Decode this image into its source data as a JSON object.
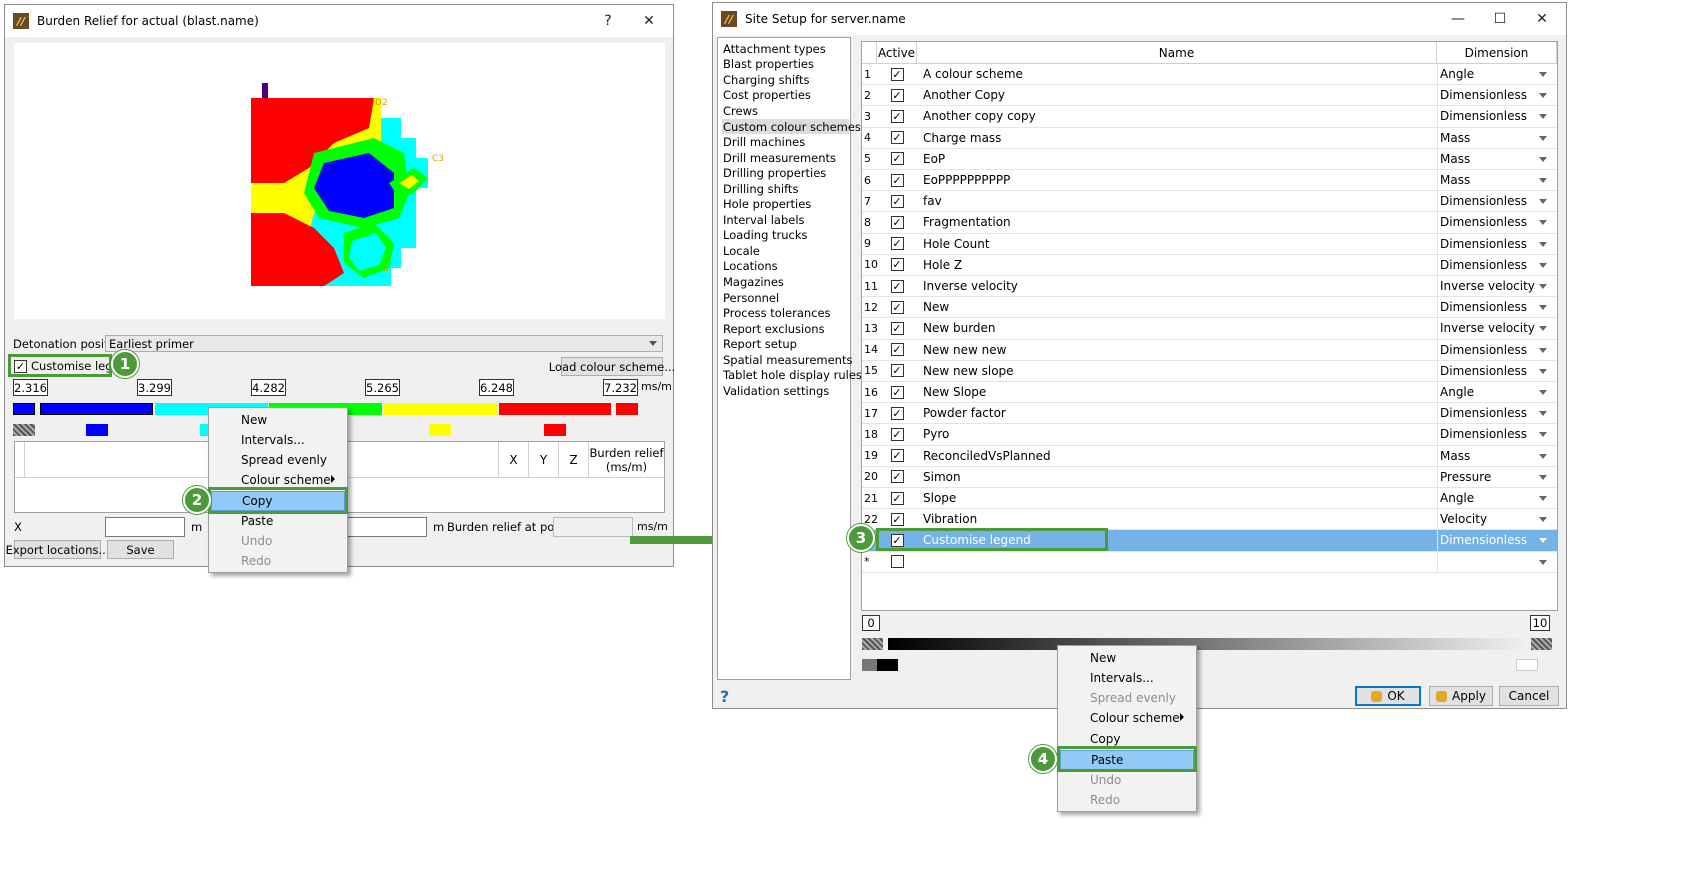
{
  "left_window": {
    "title": "Burden Relief for actual (blast.name)",
    "help_glyph": "?",
    "close_glyph": "✕",
    "plot_labels": [
      "D2",
      "C3",
      "2"
    ],
    "detonation_label": "Detonation position",
    "detonation_value": "Earliest primer",
    "customise_legend_label": "Customise legend",
    "customise_legend_checked": true,
    "load_scheme_button": "Load colour scheme...",
    "ticks": [
      "2.316",
      "3.299",
      "4.282",
      "5.265",
      "6.248",
      "7.232"
    ],
    "unit_label": "ms/m",
    "legend_colors": [
      "#0000ff",
      "#00ffff",
      "#00ff00",
      "#ffff00",
      "#ff0000"
    ],
    "table_headers": [
      "X",
      "Y",
      "Z",
      "Burden relief (ms/m)"
    ],
    "x_label": "X",
    "m_label": "m",
    "burden_relief_at_point_label": "Burden relief at point",
    "export_button": "Export locations...",
    "save_button": "Save"
  },
  "left_menu": {
    "items": [
      {
        "label": "New",
        "disabled": false
      },
      {
        "label": "Intervals...",
        "disabled": false
      },
      {
        "label": "Spread evenly",
        "disabled": false
      },
      {
        "label": "Colour scheme",
        "disabled": false,
        "submenu": true
      },
      {
        "label": "Copy",
        "disabled": false,
        "selected": true
      },
      {
        "label": "Paste",
        "disabled": false
      },
      {
        "label": "Undo",
        "disabled": true
      },
      {
        "label": "Redo",
        "disabled": true
      }
    ]
  },
  "right_window": {
    "title": "Site Setup for server.name",
    "min_glyph": "—",
    "max_glyph": "☐",
    "close_glyph": "✕",
    "sidebar_items": [
      "Attachment types",
      "Blast properties",
      "Charging shifts",
      "Cost properties",
      "Crews",
      "Custom colour schemes",
      "Drill machines",
      "Drill measurements",
      "Drilling properties",
      "Drilling shifts",
      "Hole properties",
      "Interval labels",
      "Loading trucks",
      "Locale",
      "Locations",
      "Magazines",
      "Personnel",
      "Process tolerances",
      "Report exclusions",
      "Report setup",
      "Spatial measurements",
      "Tablet hole display rules",
      "Validation settings"
    ],
    "sidebar_selected_index": 5,
    "table_headers": {
      "active": "Active",
      "name": "Name",
      "dimension": "Dimension"
    },
    "rows": [
      {
        "num": "1",
        "name": "A colour scheme",
        "dimension": "Angle"
      },
      {
        "num": "2",
        "name": "Another Copy",
        "dimension": "Dimensionless"
      },
      {
        "num": "3",
        "name": "Another copy copy",
        "dimension": "Dimensionless"
      },
      {
        "num": "4",
        "name": "Charge mass",
        "dimension": "Mass"
      },
      {
        "num": "5",
        "name": "EoP",
        "dimension": "Mass"
      },
      {
        "num": "6",
        "name": "EoPPPPPPPPPP",
        "dimension": "Mass"
      },
      {
        "num": "7",
        "name": "fav",
        "dimension": "Dimensionless"
      },
      {
        "num": "8",
        "name": "Fragmentation",
        "dimension": "Dimensionless"
      },
      {
        "num": "9",
        "name": "Hole Count",
        "dimension": "Dimensionless"
      },
      {
        "num": "10",
        "name": "Hole Z",
        "dimension": "Dimensionless"
      },
      {
        "num": "11",
        "name": "Inverse velocity",
        "dimension": "Inverse velocity"
      },
      {
        "num": "12",
        "name": "New",
        "dimension": "Dimensionless"
      },
      {
        "num": "13",
        "name": "New burden",
        "dimension": "Inverse velocity"
      },
      {
        "num": "14",
        "name": "New new new",
        "dimension": "Dimensionless"
      },
      {
        "num": "15",
        "name": "New new slope",
        "dimension": "Dimensionless"
      },
      {
        "num": "16",
        "name": "New Slope",
        "dimension": "Angle"
      },
      {
        "num": "17",
        "name": "Powder factor",
        "dimension": "Dimensionless"
      },
      {
        "num": "18",
        "name": "Pyro",
        "dimension": "Dimensionless"
      },
      {
        "num": "19",
        "name": "ReconciledVsPlanned",
        "dimension": "Mass"
      },
      {
        "num": "20",
        "name": "Simon",
        "dimension": "Pressure"
      },
      {
        "num": "21",
        "name": "Slope",
        "dimension": "Angle"
      },
      {
        "num": "22",
        "name": "Vibration",
        "dimension": "Velocity"
      },
      {
        "num": "",
        "name": "Customise legend",
        "dimension": "Dimensionless",
        "selected": true
      },
      {
        "num": "*",
        "name": "",
        "dimension": "",
        "unchecked": true
      }
    ],
    "scale_min": "0",
    "scale_max": "10",
    "ok_button": "OK",
    "apply_button": "Apply",
    "cancel_button": "Cancel",
    "help_glyph": "?"
  },
  "right_menu": {
    "items": [
      {
        "label": "New",
        "disabled": false
      },
      {
        "label": "Intervals...",
        "disabled": false
      },
      {
        "label": "Spread evenly",
        "disabled": true
      },
      {
        "label": "Colour scheme",
        "disabled": false,
        "submenu": true
      },
      {
        "label": "Copy",
        "disabled": false
      },
      {
        "label": "Paste",
        "disabled": false,
        "selected": true
      },
      {
        "label": "Undo",
        "disabled": true
      },
      {
        "label": "Redo",
        "disabled": true
      }
    ]
  },
  "step_badges": [
    "1",
    "2",
    "3",
    "4"
  ],
  "colors": {
    "accent_green": "#4c9a3a",
    "selection_blue": "#75b3e6"
  }
}
